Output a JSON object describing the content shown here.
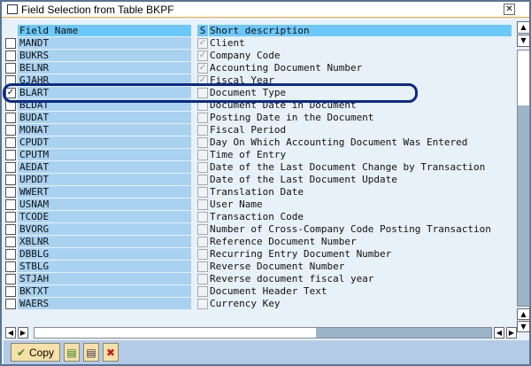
{
  "title": "Field Selection from Table BKPF",
  "header": {
    "field_name": "Field Name",
    "s": "S",
    "short_description": "Short description"
  },
  "rows": [
    {
      "field": "MANDT",
      "selected": false,
      "s": true,
      "desc": "Client"
    },
    {
      "field": "BUKRS",
      "selected": false,
      "s": true,
      "desc": "Company Code"
    },
    {
      "field": "BELNR",
      "selected": false,
      "s": true,
      "desc": "Accounting Document Number"
    },
    {
      "field": "GJAHR",
      "selected": false,
      "s": true,
      "desc": "Fiscal Year"
    },
    {
      "field": "BLART",
      "selected": true,
      "s": false,
      "desc": "Document Type"
    },
    {
      "field": "BLDAT",
      "selected": false,
      "s": false,
      "desc": "Document Date in Document"
    },
    {
      "field": "BUDAT",
      "selected": false,
      "s": false,
      "desc": "Posting Date in the Document"
    },
    {
      "field": "MONAT",
      "selected": false,
      "s": false,
      "desc": "Fiscal Period"
    },
    {
      "field": "CPUDT",
      "selected": false,
      "s": false,
      "desc": "Day On Which Accounting Document Was Entered"
    },
    {
      "field": "CPUTM",
      "selected": false,
      "s": false,
      "desc": "Time of Entry"
    },
    {
      "field": "AEDAT",
      "selected": false,
      "s": false,
      "desc": "Date of the Last Document Change by Transaction"
    },
    {
      "field": "UPDDT",
      "selected": false,
      "s": false,
      "desc": "Date of the Last Document Update"
    },
    {
      "field": "WWERT",
      "selected": false,
      "s": false,
      "desc": "Translation Date"
    },
    {
      "field": "USNAM",
      "selected": false,
      "s": false,
      "desc": "User Name"
    },
    {
      "field": "TCODE",
      "selected": false,
      "s": false,
      "desc": "Transaction Code"
    },
    {
      "field": "BVORG",
      "selected": false,
      "s": false,
      "desc": "Number of Cross-Company Code Posting Transaction"
    },
    {
      "field": "XBLNR",
      "selected": false,
      "s": false,
      "desc": "Reference Document Number"
    },
    {
      "field": "DBBLG",
      "selected": false,
      "s": false,
      "desc": "Recurring Entry Document Number"
    },
    {
      "field": "STBLG",
      "selected": false,
      "s": false,
      "desc": "Reverse Document Number"
    },
    {
      "field": "STJAH",
      "selected": false,
      "s": false,
      "desc": "Reverse document fiscal year"
    },
    {
      "field": "BKTXT",
      "selected": false,
      "s": false,
      "desc": "Document Header Text"
    },
    {
      "field": "WAERS",
      "selected": false,
      "s": false,
      "desc": "Currency Key"
    }
  ],
  "toolbar": {
    "copy": "Copy"
  },
  "scroll": {
    "vertical_position": 0,
    "horizontal_position": 0
  }
}
